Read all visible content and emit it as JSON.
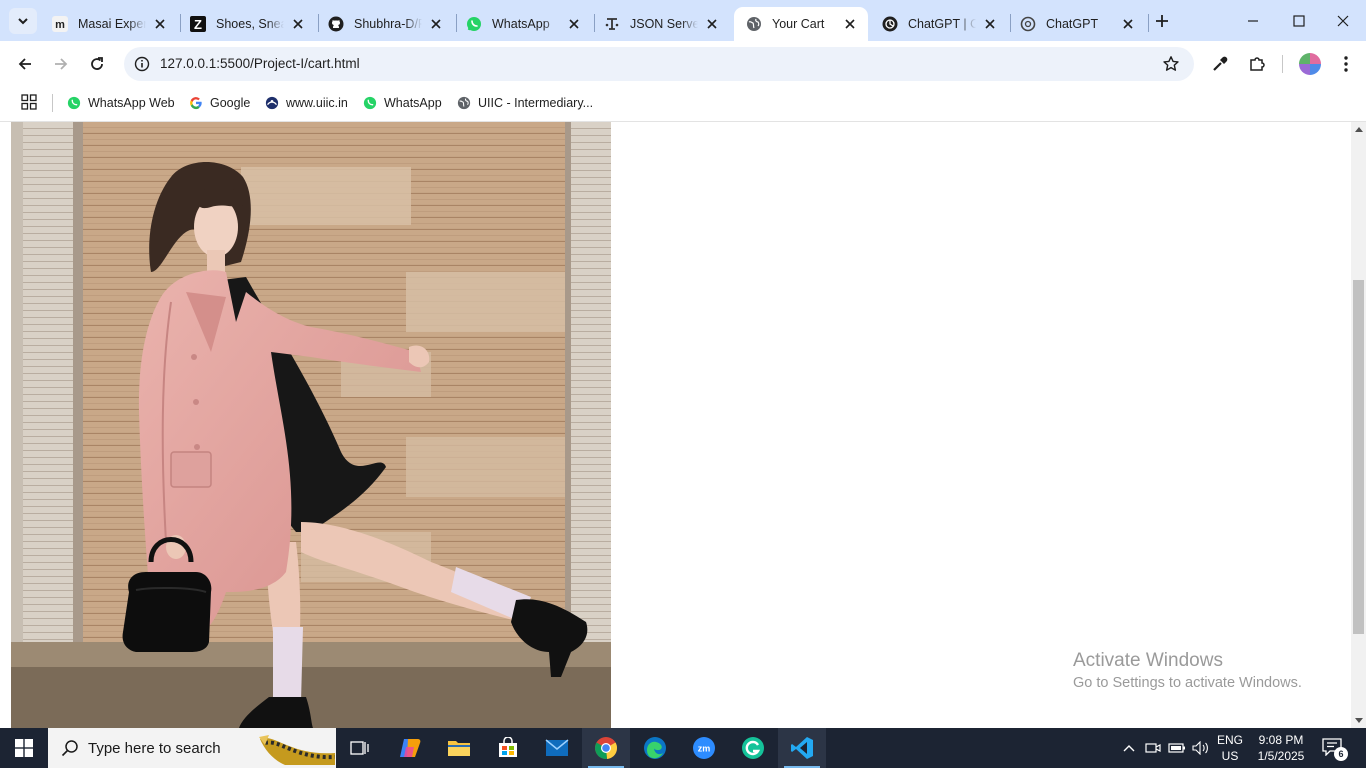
{
  "browser": {
    "tabs": [
      {
        "title": "Masai Experience",
        "favicon": "masai-icon",
        "active": false
      },
      {
        "title": "Shoes, Sneakers",
        "favicon": "zappos-icon",
        "active": false
      },
      {
        "title": "Shubhra-D/Project",
        "favicon": "github-icon",
        "active": false
      },
      {
        "title": "WhatsApp",
        "favicon": "whatsapp-icon",
        "active": false
      },
      {
        "title": "JSON Server",
        "favicon": "json-server-icon",
        "active": false
      },
      {
        "title": "Your Cart",
        "favicon": "globe-icon",
        "active": true
      },
      {
        "title": "ChatGPT | OpenAI",
        "favicon": "chatgpt-icon",
        "active": false
      },
      {
        "title": "ChatGPT",
        "favicon": "chatgpt-icon",
        "active": false
      }
    ],
    "address": {
      "url": "127.0.0.1:5500/Project-I/cart.html"
    },
    "bookmarks": [
      {
        "label": "WhatsApp Web",
        "icon": "whatsapp-icon"
      },
      {
        "label": "Google",
        "icon": "google-icon"
      },
      {
        "label": "www.uiic.in",
        "icon": "uiic-icon"
      },
      {
        "label": "WhatsApp",
        "icon": "whatsapp-icon"
      },
      {
        "label": "UIIC - Intermediary...",
        "icon": "globe-icon"
      }
    ]
  },
  "page": {
    "photo_alt": "Model in pink coat and black dress holding black handbag"
  },
  "watermark": {
    "line1": "Activate Windows",
    "line2": "Go to Settings to activate Windows."
  },
  "taskbar": {
    "search_placeholder": "Type here to search",
    "apps": [
      "task-view",
      "copilot",
      "file-explorer",
      "microsoft-store",
      "mail",
      "chrome",
      "edge",
      "zoom",
      "grammarly",
      "vscode"
    ],
    "language": {
      "line1": "ENG",
      "line2": "US"
    },
    "clock": {
      "time": "9:08 PM",
      "date": "1/5/2025"
    },
    "notification_count": "6"
  },
  "colors": {
    "tabstrip": "#d3e3fd",
    "omnibox": "#edf2fa",
    "taskbar": "#1c2433",
    "coat": "#e2a3a0",
    "whatsapp": "#25d366"
  }
}
